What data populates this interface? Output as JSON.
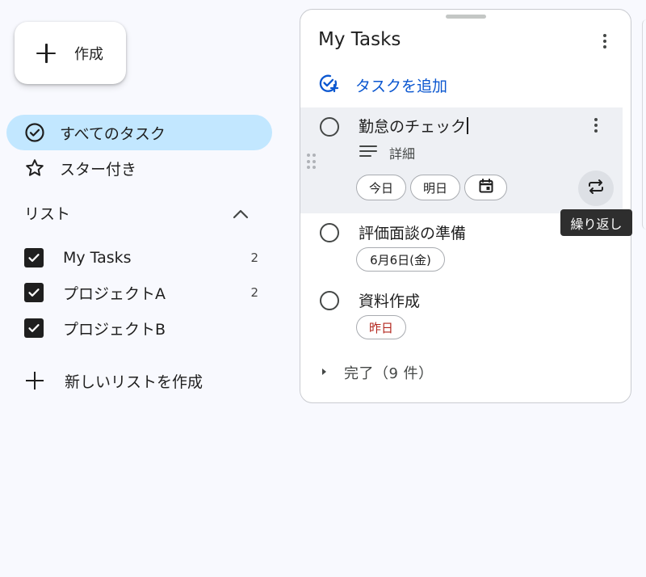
{
  "sidebar": {
    "create_label": "作成",
    "nav": [
      {
        "label": "すべてのタスク",
        "icon": "check-circle-icon",
        "active": true
      },
      {
        "label": "スター付き",
        "icon": "star-icon",
        "active": false
      }
    ],
    "lists_section": {
      "label": "リスト",
      "items": [
        {
          "name": "My Tasks",
          "count": "2",
          "checked": true
        },
        {
          "name": "プロジェクトA",
          "count": "2",
          "checked": true
        },
        {
          "name": "プロジェクトB",
          "count": "",
          "checked": true
        }
      ]
    },
    "new_list_label": "新しいリストを作成"
  },
  "panel": {
    "title": "My Tasks",
    "add_task_label": "タスクを追加",
    "tasks": [
      {
        "title": "勤怠のチェック",
        "details_label": "詳細",
        "chips": [
          "今日",
          "明日"
        ],
        "repeat_tooltip": "繰り返し"
      },
      {
        "title": "評価面談の準備",
        "due": "6月6日(金)"
      },
      {
        "title": "資料作成",
        "due": "昨日",
        "overdue": true
      }
    ],
    "completed_label": "完了（9 件）"
  },
  "colors": {
    "accent_blue": "#0b57d0",
    "active_nav_bg": "#c2e7ff",
    "overdue_red": "#b3261e"
  }
}
